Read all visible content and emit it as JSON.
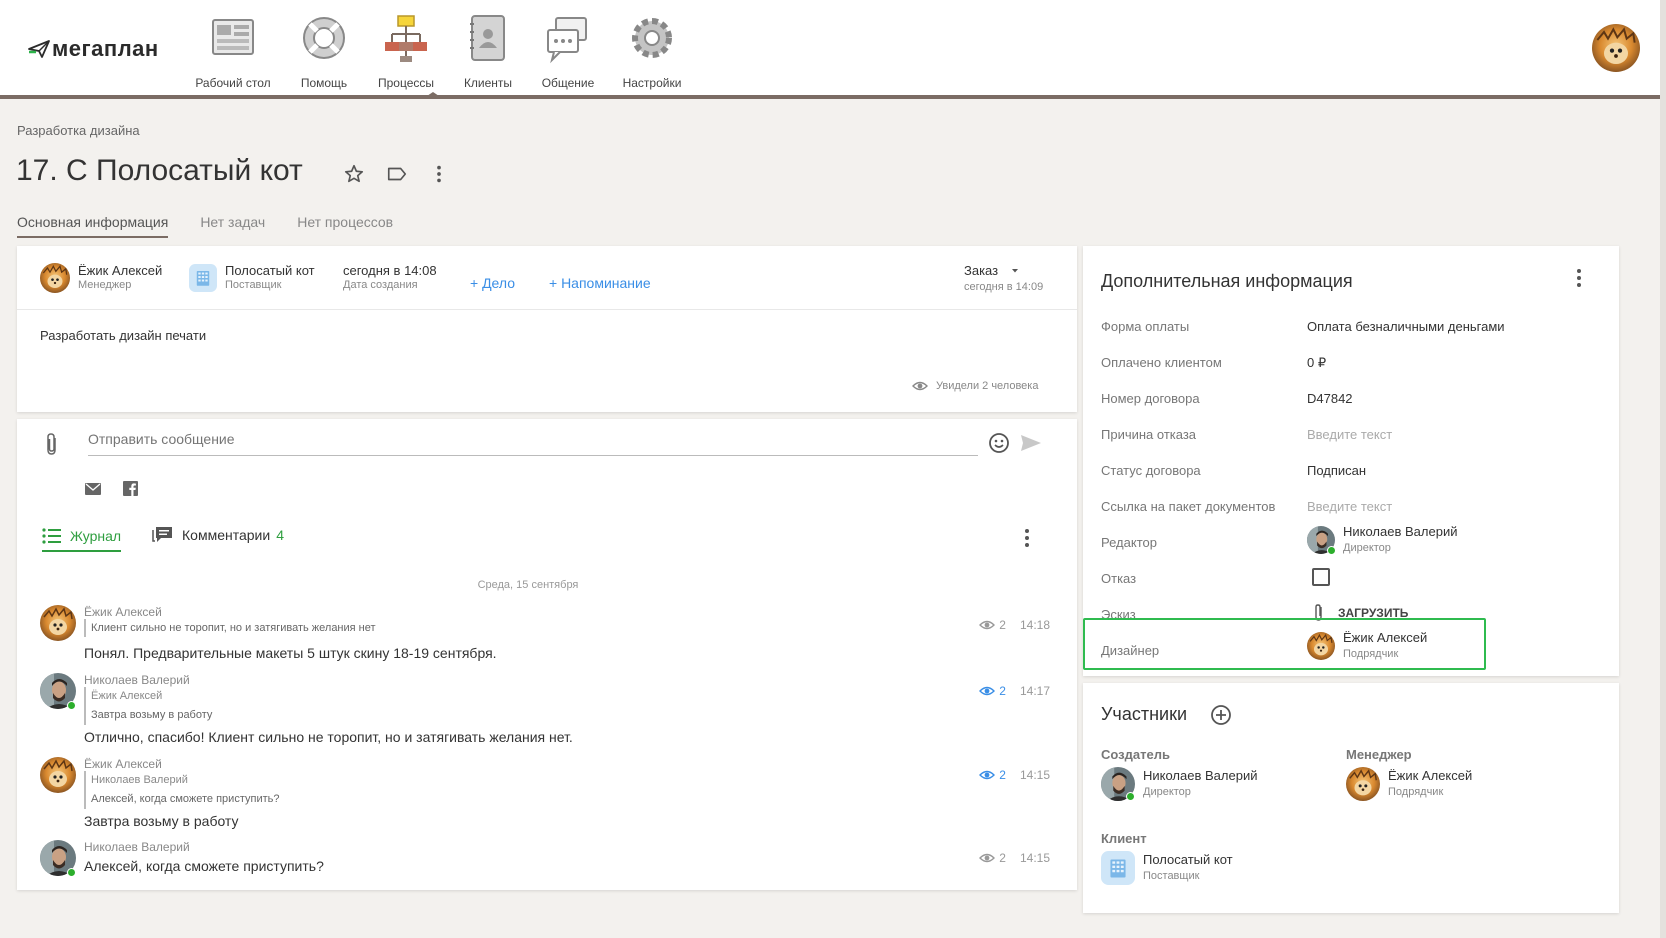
{
  "nav": {
    "logo": "мегаплан",
    "items": [
      {
        "label": "Рабочий стол",
        "icon": "dashboard-icon"
      },
      {
        "label": "Помощь",
        "icon": "lifebuoy-icon"
      },
      {
        "label": "Процессы",
        "icon": "process-icon"
      },
      {
        "label": "Клиенты",
        "icon": "address-book-icon"
      },
      {
        "label": "Общение",
        "icon": "chat-icon"
      },
      {
        "label": "Настройки",
        "icon": "gear-icon"
      }
    ],
    "active": "Процессы"
  },
  "page": {
    "breadcrumb": "Разработка дизайна",
    "title": "17. С Полосатый кот",
    "tabs": [
      {
        "label": "Основная информация",
        "active": true
      },
      {
        "label": "Нет задач",
        "active": false
      },
      {
        "label": "Нет процессов",
        "active": false
      }
    ]
  },
  "deal": {
    "manager": {
      "name": "Ёжик Алексей",
      "role": "Менеджер"
    },
    "supplier": {
      "name": "Полосатый кот",
      "role": "Поставщик"
    },
    "created": {
      "value": "сегодня в 14:08",
      "label": "Дата создания"
    },
    "add_task": "+ Дело",
    "add_reminder": "+ Напоминание",
    "status": {
      "value": "Заказ",
      "time": "сегодня в 14:09"
    },
    "description": "Разработать дизайн печати",
    "seen": "Увидели 2 человека"
  },
  "composer": {
    "placeholder": "Отправить сообщение"
  },
  "feed": {
    "tab_journal": "Журнал",
    "tab_comments": "Комментарии",
    "comments_count": "4",
    "date": "Среда, 15 сентября",
    "entries": [
      {
        "author": "Ёжик Алексей",
        "quote_author": "",
        "quote": "Клиент сильно не торопит, но и затягивать желания нет",
        "text": "Понял. Предварительные макеты 5 штук скину 18-19 сентября.",
        "views": "2",
        "time": "14:18"
      },
      {
        "author": "Николаев Валерий",
        "quote_author": "Ёжик Алексей",
        "quote": "Завтра возьму в работу",
        "text": "Отлично, спасибо! Клиент сильно не торопит, но и затягивать желания нет.",
        "views": "2",
        "time": "14:17"
      },
      {
        "author": "Ёжик Алексей",
        "quote_author": "Николаев Валерий",
        "quote": "Алексей, когда сможете приступить?",
        "text": "Завтра возьму в работу",
        "views": "2",
        "time": "14:15"
      },
      {
        "author": "Николаев Валерий",
        "quote_author": "",
        "quote": "",
        "text": "Алексей, когда сможете приступить?",
        "views": "2",
        "time": "14:15"
      }
    ]
  },
  "info": {
    "title": "Дополнительная информация",
    "rows": [
      {
        "label": "Форма оплаты",
        "value": "Оплата безналичными деньгами"
      },
      {
        "label": "Оплачено клиентом",
        "value": "0 ₽"
      },
      {
        "label": "Номер договора",
        "value": "D47842"
      },
      {
        "label": "Причина отказа",
        "value": "Введите текст"
      },
      {
        "label": "Статус договора",
        "value": "Подписан"
      },
      {
        "label": "Ссылка на пакет документов",
        "value": "Введите текст"
      },
      {
        "label": "Редактор",
        "name": "Николаев Валерий",
        "role": "Директор"
      },
      {
        "label": "Отказ"
      },
      {
        "label": "Эскиз",
        "value": "ЗАГРУЗИТЬ"
      },
      {
        "label": "Дизайнер",
        "name": "Ёжик Алексей",
        "role": "Подрядчик"
      }
    ]
  },
  "participants": {
    "title": "Участники",
    "creator_label": "Создатель",
    "creator": {
      "name": "Николаев Валерий",
      "role": "Директор"
    },
    "manager_label": "Менеджер",
    "manager": {
      "name": "Ёжик Алексей",
      "role": "Подрядчик"
    },
    "client_label": "Клиент",
    "client": {
      "name": "Полосатый кот",
      "role": "Поставщик"
    }
  },
  "colors": {
    "accent_link": "#3a8ee6",
    "journal_green": "#2e9e3f",
    "highlight": "#2fbb4f",
    "nav_bar": "#7b6c64"
  }
}
